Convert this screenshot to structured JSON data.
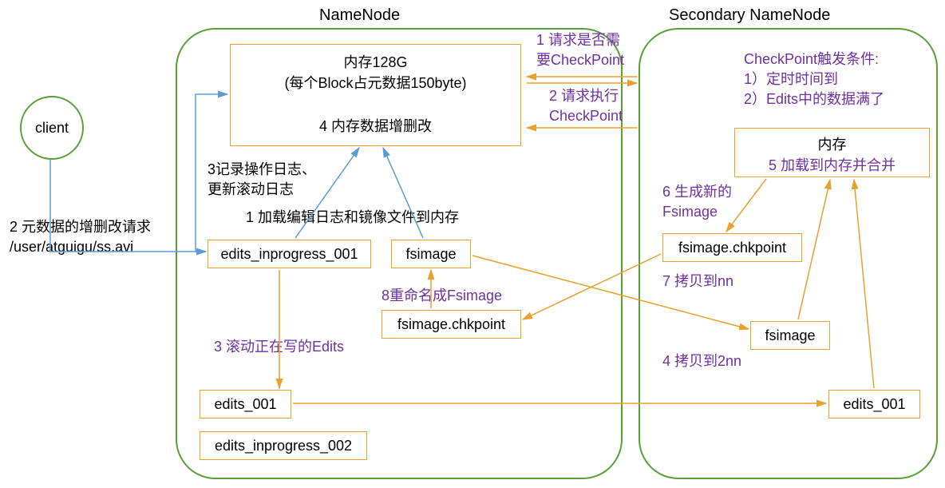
{
  "titles": {
    "namenode": "NameNode",
    "secondary": "Secondary NameNode"
  },
  "client": {
    "label": "client"
  },
  "memoryBox": {
    "line1": "内存128G",
    "line2": "(每个Block占元数据150byte)",
    "line3": "4 内存数据增删改"
  },
  "labels": {
    "reqMeta1": "2 元数据的增删改请求",
    "reqMeta2": "/user/atguigu/ss.avi",
    "logUpdate1": "3记录操作日志、",
    "logUpdate2": "更新滚动日志",
    "loadEdits": "1 加载编辑日志和镜像文件到内存",
    "rollEdits": "3 滚动正在写的Edits",
    "rename": "8重命名成Fsimage",
    "reqCheckpoint1": "1 请求是否需",
    "reqCheckpoint2": "要CheckPoint",
    "execCheckpoint1": "2 请求执行",
    "execCheckpoint2": "CheckPoint",
    "triggerTitle": "CheckPoint触发条件:",
    "trigger1": "1）定时时间到",
    "trigger2": "2）Edits中的数据满了",
    "genFsimage1": "6 生成新的",
    "genFsimage2": "Fsimage",
    "copyNN": "7 拷贝到nn",
    "copy2NN": "4 拷贝到2nn"
  },
  "boxes": {
    "editsInprogress001": "edits_inprogress_001",
    "fsimage": "fsimage",
    "fsimageChkpoint": "fsimage.chkpoint",
    "edits001": "edits_001",
    "editsInprogress002": "edits_inprogress_002",
    "secMemory1": "内存",
    "secMemory2": "5 加载到内存并合并",
    "secFsimageChkpoint": "fsimage.chkpoint",
    "secFsimage": "fsimage",
    "secEdits001": "edits_001"
  }
}
